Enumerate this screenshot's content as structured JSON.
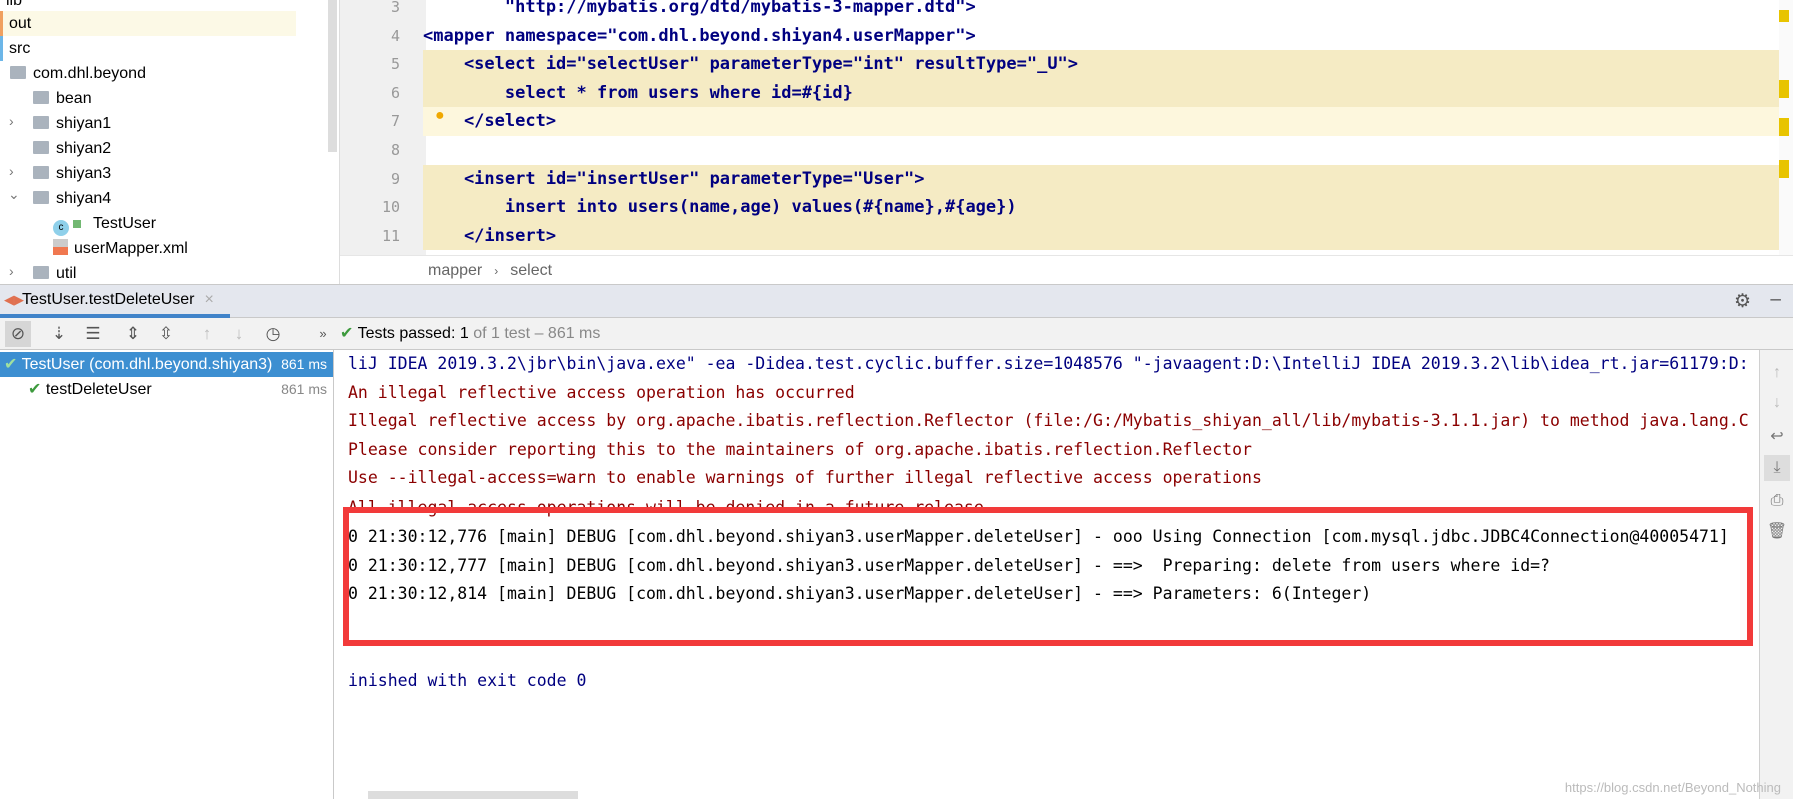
{
  "project_tree": {
    "items": [
      {
        "label": "lib"
      },
      {
        "label": "out"
      },
      {
        "label": "src"
      },
      {
        "label": "com.dhl.beyond"
      },
      {
        "label": "bean"
      },
      {
        "label": "shiyan1"
      },
      {
        "label": "shiyan2"
      },
      {
        "label": "shiyan3"
      },
      {
        "label": "shiyan4"
      },
      {
        "label": "TestUser"
      },
      {
        "label": "userMapper.xml"
      },
      {
        "label": "util"
      }
    ]
  },
  "editor": {
    "lines": [
      {
        "n": "3",
        "code": "        \"http://mybatis.org/dtd/mybatis-3-mapper.dtd\">"
      },
      {
        "n": "4",
        "code": "<mapper namespace=\"com.dhl.beyond.shiyan4.userMapper\">"
      },
      {
        "n": "5",
        "code": "    <select id=\"selectUser\" parameterType=\"int\" resultType=\"_U\">"
      },
      {
        "n": "6",
        "code": "        select * from users where id=#{id}"
      },
      {
        "n": "7",
        "code": "    </select>"
      },
      {
        "n": "8",
        "code": ""
      },
      {
        "n": "9",
        "code": "    <insert id=\"insertUser\" parameterType=\"User\">"
      },
      {
        "n": "10",
        "code": "        insert into users(name,age) values(#{name},#{age})"
      },
      {
        "n": "11",
        "code": "    </insert>"
      }
    ],
    "breadcrumb": [
      "mapper",
      "select"
    ]
  },
  "run": {
    "tab_label": "TestUser.testDeleteUser",
    "status": {
      "prefix": "Tests passed:",
      "count": "1",
      "rest": "of 1 test – 861 ms"
    },
    "tests": [
      {
        "label": "TestUser (com.dhl.beyond.shiyan3)",
        "time": "861 ms"
      },
      {
        "label": "testDeleteUser",
        "time": "861 ms"
      }
    ],
    "console": [
      {
        "type": "out",
        "text": "liJ IDEA 2019.3.2\\jbr\\bin\\java.exe\" -ea -Didea.test.cyclic.buffer.size=1048576 \"-javaagent:D:\\IntelliJ IDEA 2019.3.2\\lib\\idea_rt.jar=61179:D:"
      },
      {
        "type": "err",
        "text": "An illegal reflective access operation has occurred"
      },
      {
        "type": "err",
        "text": "Illegal reflective access by org.apache.ibatis.reflection.Reflector (file:/G:/Mybatis_shiyan_all/lib/mybatis-3.1.1.jar) to method java.lang.C"
      },
      {
        "type": "err",
        "text": "Please consider reporting this to the maintainers of org.apache.ibatis.reflection.Reflector"
      },
      {
        "type": "err",
        "text": "Use --illegal-access=warn to enable warnings of further illegal reflective access operations"
      },
      {
        "type": "err",
        "text": "All illegal access operations will be denied in a future release"
      },
      {
        "type": "dbg",
        "text": "0 21:30:12,776 [main] DEBUG [com.dhl.beyond.shiyan3.userMapper.deleteUser] - ooo Using Connection [com.mysql.jdbc.JDBC4Connection@40005471]"
      },
      {
        "type": "dbg",
        "text": "0 21:30:12,777 [main] DEBUG [com.dhl.beyond.shiyan3.userMapper.deleteUser] - ==>  Preparing: delete from users where id=?"
      },
      {
        "type": "dbg",
        "text": "0 21:30:12,814 [main] DEBUG [com.dhl.beyond.shiyan3.userMapper.deleteUser] - ==> Parameters: 6(Integer)"
      },
      {
        "type": "out",
        "text": "inished with exit code 0"
      }
    ]
  },
  "watermark": "https://blog.csdn.net/Beyond_Nothing",
  "colors": {
    "accent": "#4083c9",
    "highlight_box": "#f23a3a",
    "success": "#3d9a3d"
  }
}
